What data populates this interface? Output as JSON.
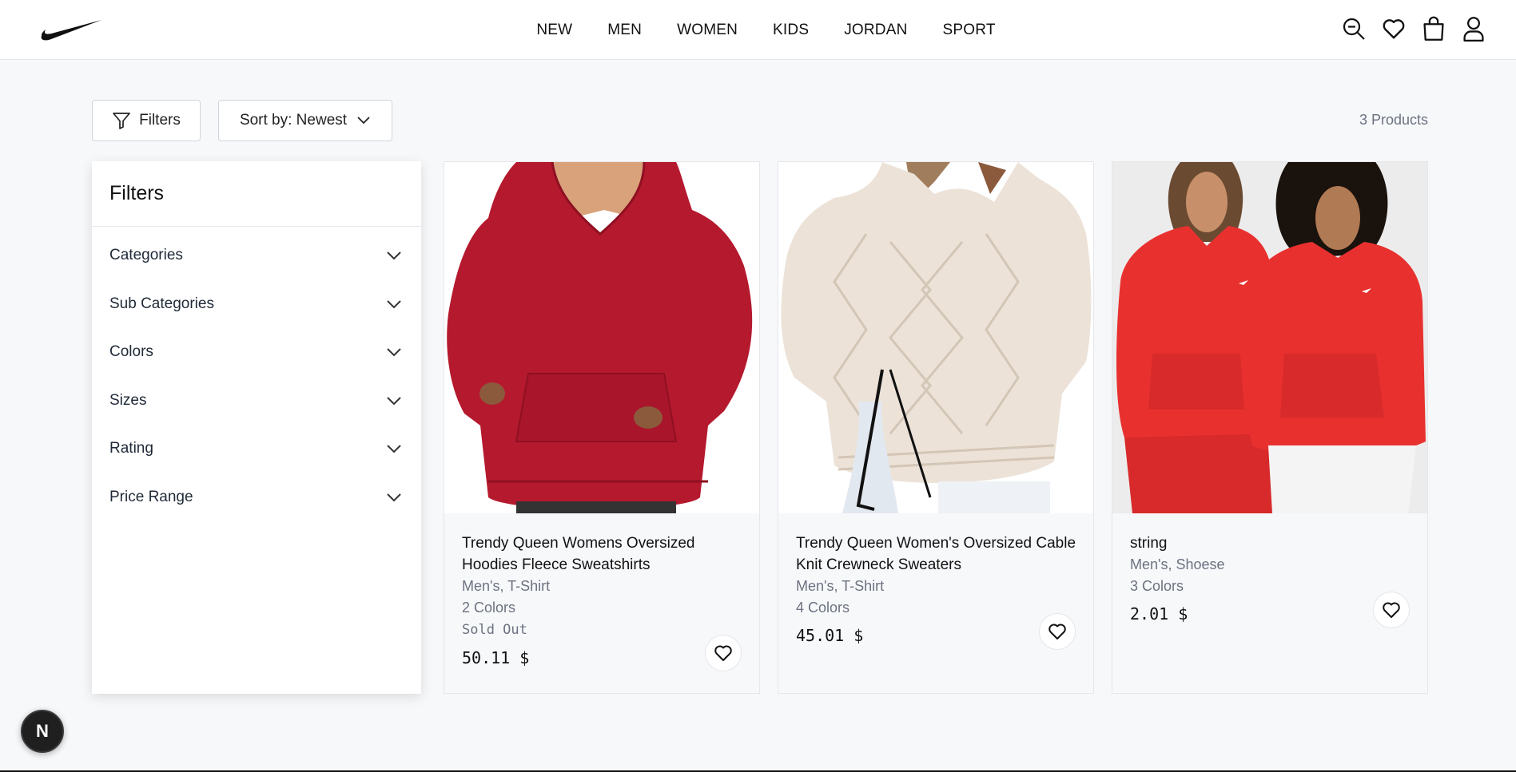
{
  "brand": {
    "logo_icon": "nike-swoosh-icon"
  },
  "nav": {
    "items": [
      "NEW",
      "MEN",
      "WOMEN",
      "KIDS",
      "JORDAN",
      "SPORT"
    ]
  },
  "header_icons": [
    "search-icon",
    "heart-icon",
    "shopping-bag-icon",
    "user-icon"
  ],
  "toolbar": {
    "filters_label": "Filters",
    "sort_label": "Sort by: Newest",
    "products_count": "3 Products"
  },
  "sidebar": {
    "title": "Filters",
    "items": [
      {
        "label": "Categories"
      },
      {
        "label": "Sub Categories"
      },
      {
        "label": "Colors"
      },
      {
        "label": "Sizes"
      },
      {
        "label": "Rating"
      },
      {
        "label": "Price Range"
      }
    ]
  },
  "products": [
    {
      "title": "Trendy Queen Womens Oversized Hoodies Fleece Sweatshirts",
      "category": "Men's, T-Shirt",
      "colors": "2 Colors",
      "status": "Sold Out",
      "price": "50.11 $",
      "image_color": "#b5192e"
    },
    {
      "title": "Trendy Queen Women's Oversized Cable Knit Crewneck Sweaters",
      "category": "Men's, T-Shirt",
      "colors": "4 Colors",
      "price": "45.01 $",
      "image_color": "#ece2d8"
    },
    {
      "title": "string",
      "category": "Men's, Shoese",
      "colors": "3 Colors",
      "price": "2.01 $",
      "image_color": "#e8312f"
    }
  ],
  "dev_badge": {
    "label": "N"
  }
}
